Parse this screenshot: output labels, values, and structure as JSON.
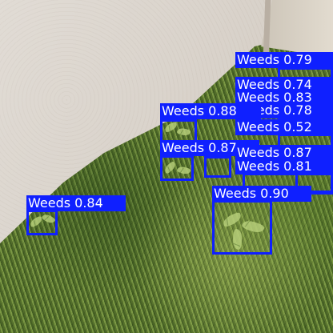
{
  "image": {
    "scene": "grassy ground beside a white textured wall",
    "accent_color": "#0f20ff",
    "label_text_color": "#ffffff"
  },
  "detections": [
    {
      "class_name": "Weeds",
      "confidence": "0.79"
    },
    {
      "class_name": "Weeds",
      "confidence": "0.74"
    },
    {
      "class_name": "Weeds",
      "confidence": "0.83"
    },
    {
      "class_name": "Weeds",
      "confidence": "0.78"
    },
    {
      "class_name": "Weeds",
      "confidence": "0.88"
    },
    {
      "class_name": "Weeds",
      "confidence": "0.52"
    },
    {
      "class_name": "Weeds",
      "confidence": "0.87"
    },
    {
      "class_name": "Weeds",
      "confidence": "0.87"
    },
    {
      "class_name": "Weeds",
      "confidence": "0.81"
    },
    {
      "class_name": "Weeds",
      "confidence": "0.90"
    },
    {
      "class_name": "Weeds",
      "confidence": "0.84"
    }
  ]
}
